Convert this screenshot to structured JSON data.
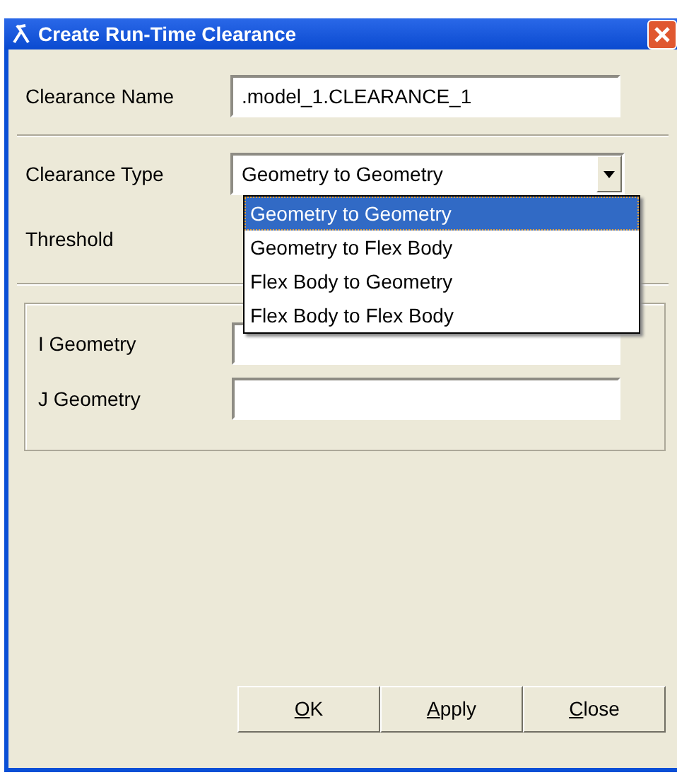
{
  "window": {
    "title": "Create Run-Time Clearance"
  },
  "fields": [
    {
      "label": "Clearance Name",
      "value": ".model_1.CLEARANCE_1"
    }
  ],
  "clearance_type": {
    "label": "Clearance Type",
    "value": "Geometry to Geometry",
    "expanded": true,
    "options": [
      {
        "label": "Geometry to Geometry",
        "selected": true
      },
      {
        "label": "Geometry to Flex Body",
        "selected": false
      },
      {
        "label": "Flex Body to Geometry",
        "selected": false
      },
      {
        "label": "Flex Body to Flex Body",
        "selected": false
      }
    ]
  },
  "threshold": {
    "label": "Threshold"
  },
  "group_fields": [
    {
      "label": "I Geometry"
    },
    {
      "label": "J Geometry"
    }
  ],
  "buttons": [
    {
      "label": "OK"
    },
    {
      "label": "Apply"
    },
    {
      "label": "Close"
    }
  ]
}
